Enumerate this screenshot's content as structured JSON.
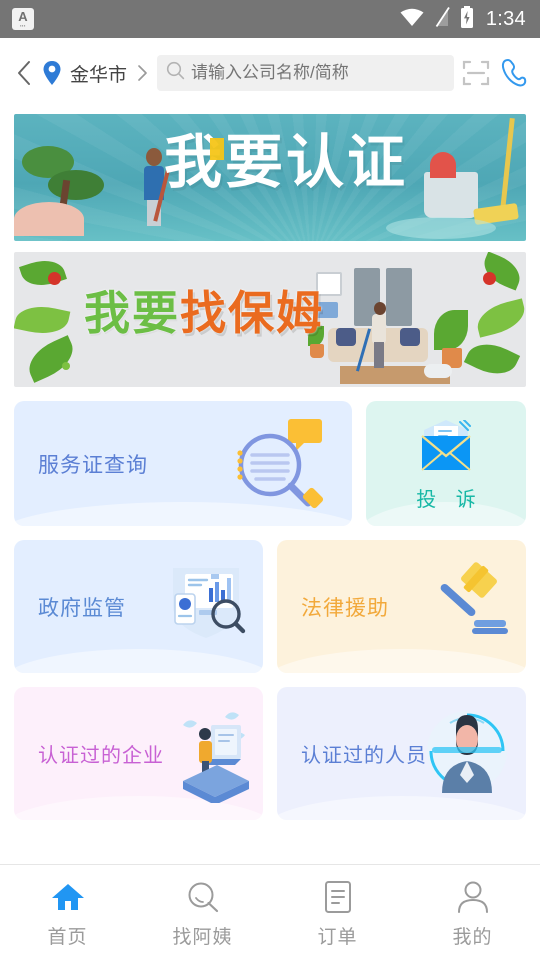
{
  "statusbar": {
    "app_icon_letter": "A",
    "app_icon_sub": "≡",
    "time": "1:34",
    "icons": [
      "wifi-icon",
      "signal-off-icon",
      "battery-charging-icon"
    ]
  },
  "header": {
    "back_icon": "chevron-left-icon",
    "location_icon": "map-pin-icon",
    "city": "金华市",
    "city_chevron_icon": "chevron-right-icon",
    "search": {
      "icon": "search-icon",
      "value": "",
      "placeholder": "请输入公司名称/简称"
    },
    "scan_icon": "scan-qr-icon",
    "phone_icon": "phone-call-icon"
  },
  "banners": [
    {
      "name": "certification-banner",
      "title": "我要认证",
      "bg_color": "#4ea7b5",
      "title_color": "#ffffff",
      "accent_color": "#f5c518"
    },
    {
      "name": "find-nanny-banner",
      "title_part1": "我要",
      "title_part2": "找保姆",
      "bg_color": "#e6e7e9",
      "part1_color": "#6cbe45",
      "part2_color": "#ea6b1f"
    }
  ],
  "cards": {
    "service": {
      "label": "服务证查询",
      "bg": "#e3eeff",
      "text_color": "#5b7fd4",
      "icon": "magnifier-document-icon"
    },
    "complaint": {
      "label": "投  诉",
      "bg": "#ddf5f0",
      "text_color": "#17b8a6",
      "icon": "envelope-icon"
    },
    "government": {
      "label": "政府监管",
      "bg": "#e3eeff",
      "text_color": "#5b8ad4",
      "icon": "dashboard-search-icon"
    },
    "legal": {
      "label": "法律援助",
      "bg": "#fdf2dc",
      "text_color": "#f2a93b",
      "icon": "gavel-icon"
    },
    "enterprise": {
      "label": "认证过的企业",
      "bg": "#fdf0fb",
      "text_color": "#c861d4",
      "icon": "person-book-icon"
    },
    "personnel": {
      "label": "认证过的人员",
      "bg": "#edf0fd",
      "text_color": "#5b7fd4",
      "icon": "face-scan-icon"
    }
  },
  "bottom_nav": {
    "active_color": "#2196f3",
    "inactive_color": "#9b9b9b",
    "items": [
      {
        "label": "首页",
        "icon": "home-icon",
        "active": true
      },
      {
        "label": "找阿姨",
        "icon": "search-icon",
        "active": false
      },
      {
        "label": "订单",
        "icon": "order-list-icon",
        "active": false
      },
      {
        "label": "我的",
        "icon": "user-icon",
        "active": false
      }
    ]
  }
}
